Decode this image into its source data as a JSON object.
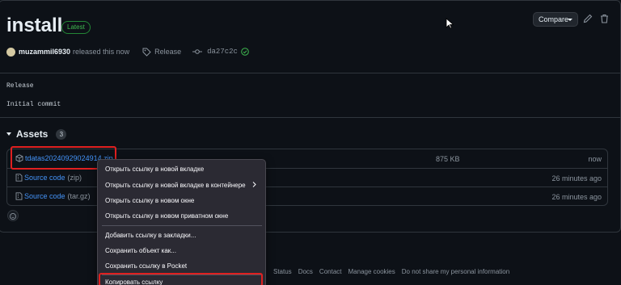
{
  "release": {
    "title": "install",
    "badge": "Latest",
    "user": "muzammil6930",
    "action_text": "released this now",
    "tag_label": "Release",
    "commit_sha": "da27c2c",
    "compare_label": "Compare",
    "notes": [
      "Release",
      "Initial commit"
    ]
  },
  "assets": {
    "heading": "Assets",
    "count": "3",
    "items": [
      {
        "name": "tdatas20240929024914.zip",
        "ext": "",
        "size": "875 KB",
        "time": "now"
      },
      {
        "name": "Source code",
        "ext": "(zip)",
        "size": "",
        "time": "26 minutes ago"
      },
      {
        "name": "Source code",
        "ext": "(tar.gz)",
        "size": "",
        "time": "26 minutes ago"
      }
    ]
  },
  "context_menu": {
    "items": [
      "Открыть ссылку в новой вкладке",
      "Открыть ссылку в новой вкладке в контейнере",
      "Открыть ссылку в новом окне",
      "Открыть ссылку в новом приватном окне",
      "Добавить ссылку в закладки...",
      "Сохранить объект как...",
      "Сохранить ссылку в Pocket",
      "Копировать ссылку"
    ]
  },
  "footer": {
    "links": [
      "Status",
      "Docs",
      "Contact",
      "Manage cookies",
      "Do not share my personal information"
    ]
  },
  "colors": {
    "background": "#0d1117",
    "link": "#4493f8",
    "badge_green": "#3fb950",
    "highlight_red": "#e02020",
    "menu_bg": "#2b2a33"
  }
}
